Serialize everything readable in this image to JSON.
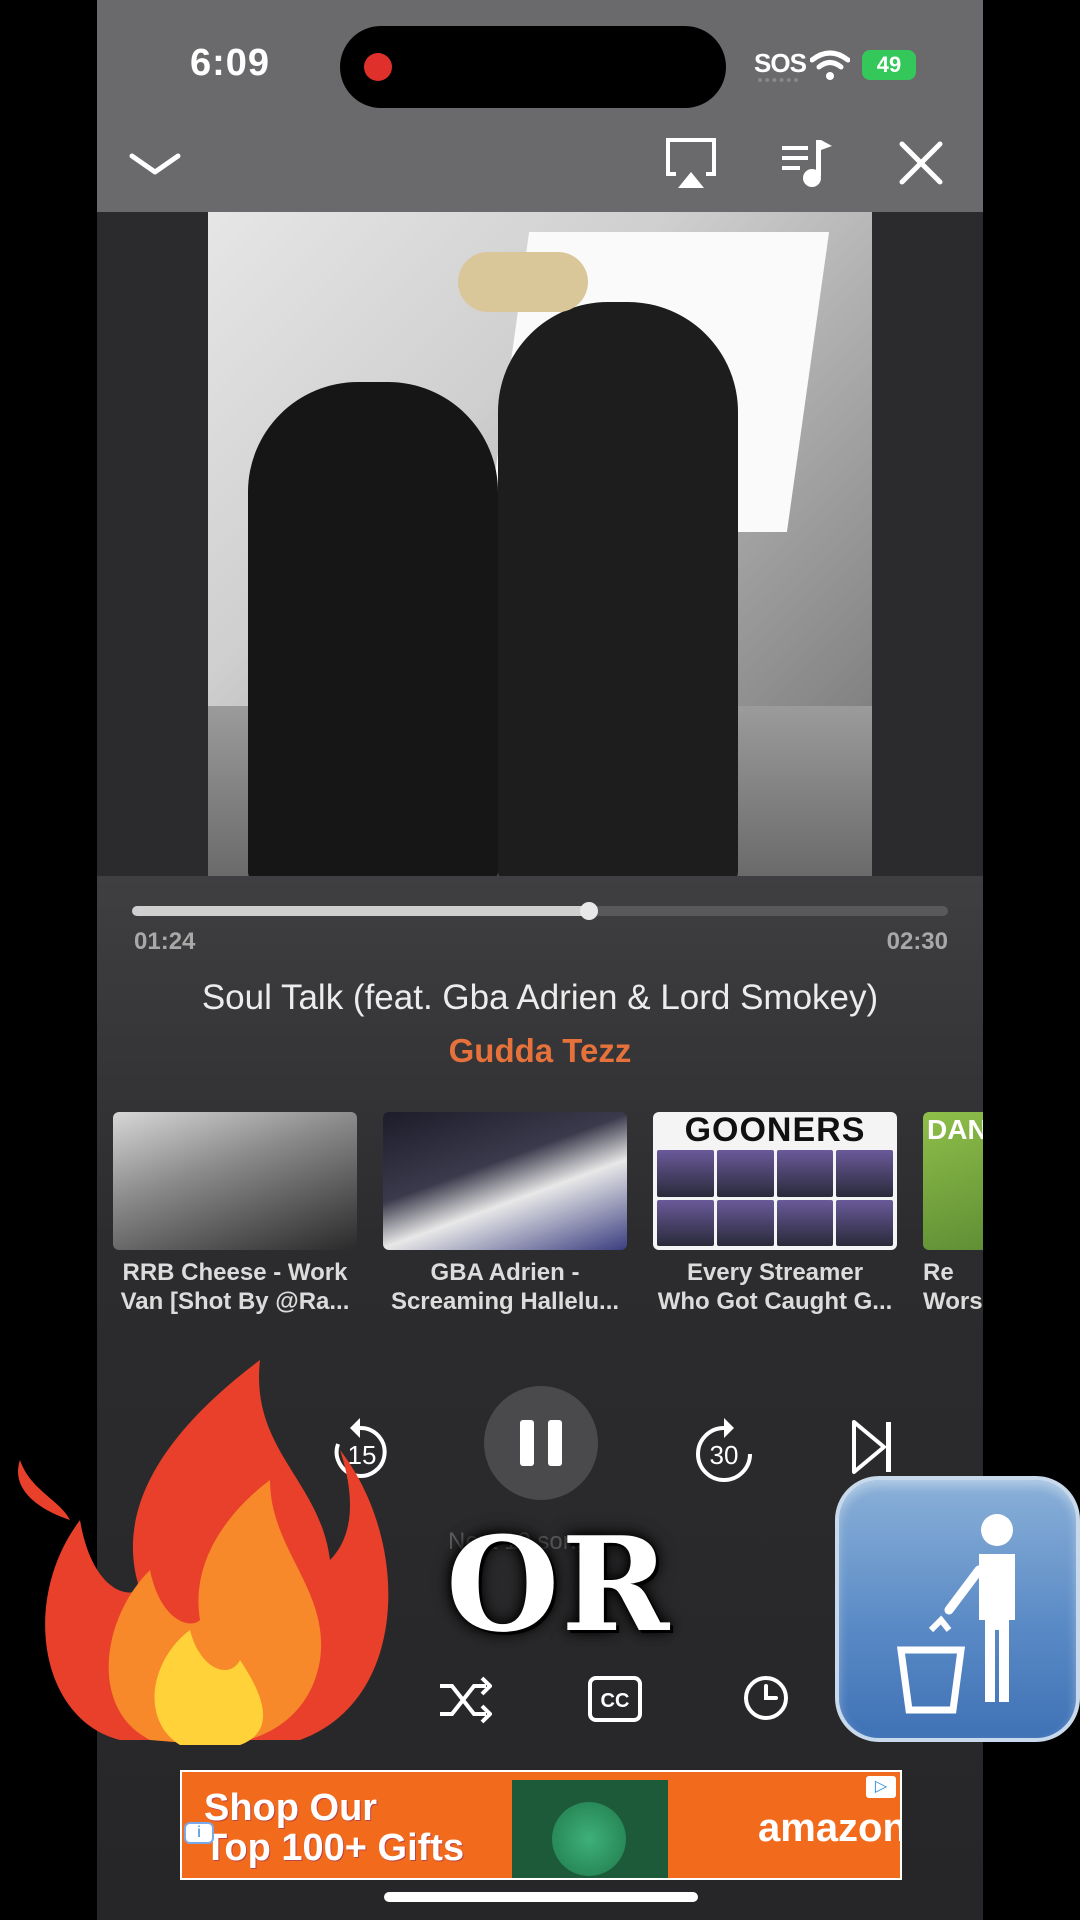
{
  "status_bar": {
    "time": "6:09",
    "carrier": "SOS",
    "battery": "49"
  },
  "toolbar": {
    "collapse_icon": "chevron-down-icon",
    "airplay_icon": "airplay-icon",
    "queue_icon": "queue-music-icon",
    "close_icon": "close-icon"
  },
  "player": {
    "elapsed": "01:24",
    "duration": "02:30",
    "progress_fraction": 0.56,
    "title": "Soul Talk (feat. Gba Adrien & Lord Smokey)",
    "artist": "Gudda Tezz"
  },
  "recommendations": [
    {
      "line1": "RRB Cheese - Work",
      "line2": "Van [Shot By @Ra..."
    },
    {
      "line1": "GBA Adrien -",
      "line2": "Screaming Hallelu..."
    },
    {
      "line1": "Every Streamer",
      "line2": "Who Got Caught G...",
      "thumb_headline": "GOONERS"
    },
    {
      "line1": "Re",
      "line2": "Wors",
      "thumb_headline": "DANC"
    }
  ],
  "controls": {
    "rewind_label": "15",
    "forward_label": "30",
    "next_up": "Next 10 songs"
  },
  "overlay": {
    "or_text": "OR"
  },
  "ad": {
    "line1": "Shop Our",
    "line2": "Top 100+ Gifts",
    "brand": "amazon"
  },
  "colors": {
    "accent": "#e7713a",
    "battery": "#34c759",
    "recording": "#e0302b"
  }
}
